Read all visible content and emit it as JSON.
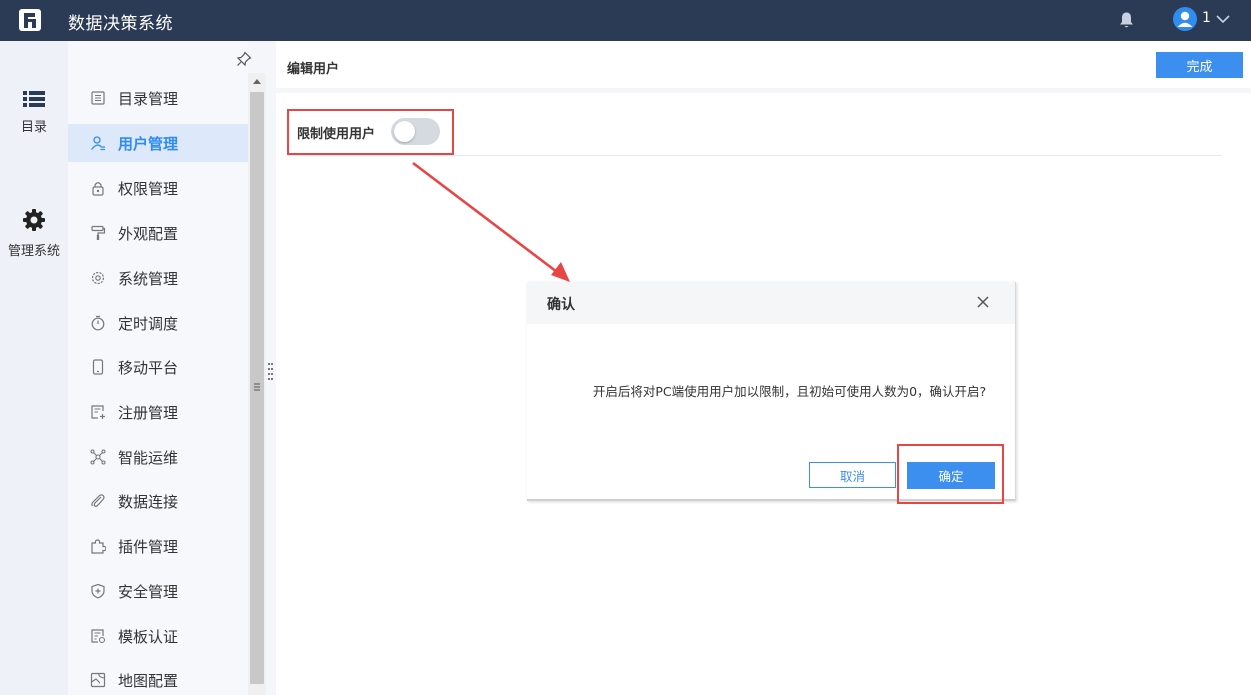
{
  "app": {
    "title": "数据决策系统",
    "user_name": "1"
  },
  "rail": {
    "items": [
      {
        "label": "目录",
        "icon": "list-icon"
      },
      {
        "label": "管理系统",
        "icon": "gear-icon"
      }
    ]
  },
  "sidebar": {
    "items": [
      {
        "label": "目录管理",
        "icon": "directory-icon"
      },
      {
        "label": "用户管理",
        "icon": "user-icon",
        "active": true
      },
      {
        "label": "权限管理",
        "icon": "lock-icon"
      },
      {
        "label": "外观配置",
        "icon": "paint-roller-icon"
      },
      {
        "label": "系统管理",
        "icon": "gear-icon"
      },
      {
        "label": "定时调度",
        "icon": "timer-icon"
      },
      {
        "label": "移动平台",
        "icon": "mobile-icon"
      },
      {
        "label": "注册管理",
        "icon": "register-icon"
      },
      {
        "label": "智能运维",
        "icon": "network-icon"
      },
      {
        "label": "数据连接",
        "icon": "link-icon"
      },
      {
        "label": "插件管理",
        "icon": "puzzle-icon"
      },
      {
        "label": "安全管理",
        "icon": "shield-icon"
      },
      {
        "label": "模板认证",
        "icon": "template-icon"
      },
      {
        "label": "地图配置",
        "icon": "map-icon"
      }
    ]
  },
  "main": {
    "title": "编辑用户",
    "done_label": "完成",
    "restrict_label": "限制使用用户",
    "restrict_enabled": false
  },
  "dialog": {
    "title": "确认",
    "message": "开启后将对PC端使用用户加以限制，且初始可使用人数为0，确认开启?",
    "cancel_label": "取消",
    "ok_label": "确定"
  },
  "colors": {
    "topbar": "#2b3a55",
    "accent": "#3c8fef",
    "highlight": "#e84545"
  }
}
